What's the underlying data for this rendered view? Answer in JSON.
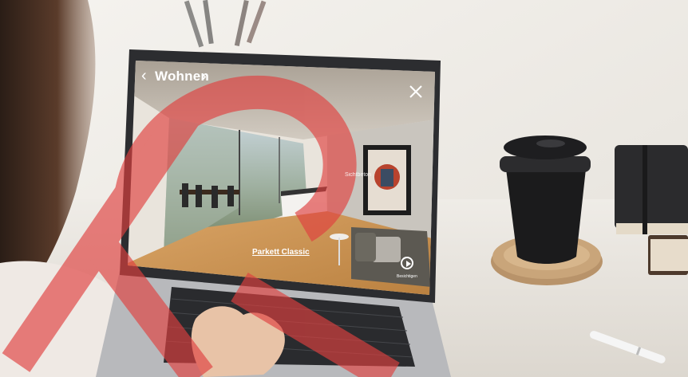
{
  "viewer": {
    "room_title": "Wohnen",
    "prev_icon": "chevron-left-icon",
    "next_icon": "chevron-right-icon",
    "close_icon": "close-icon",
    "hotspot_floor": "Parkett Classic",
    "hotspot_wall": "Sichtbeton",
    "play_icon": "play-icon",
    "play_label": "Besichtigen"
  },
  "colors": {
    "watermark": "#e0403f",
    "coffee_cup": "#1b1b1c",
    "cork": "#c9a57a",
    "notebook": "#2b2b2d"
  }
}
